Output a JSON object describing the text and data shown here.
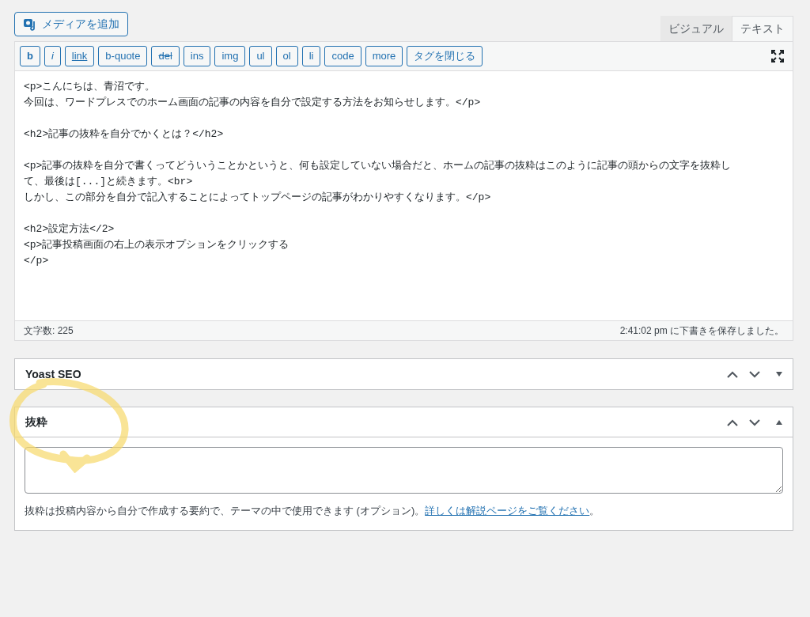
{
  "media_button": {
    "label": "メディアを追加"
  },
  "editor_tabs": [
    {
      "label": "ビジュアル",
      "selected": false
    },
    {
      "label": "テキスト",
      "selected": true
    }
  ],
  "quicktags": [
    {
      "label": "b",
      "kind": "bold"
    },
    {
      "label": "i",
      "kind": "italic"
    },
    {
      "label": "link",
      "kind": "underline"
    },
    {
      "label": "b-quote",
      "kind": "plain"
    },
    {
      "label": "del",
      "kind": "strike"
    },
    {
      "label": "ins",
      "kind": "plain"
    },
    {
      "label": "img",
      "kind": "plain"
    },
    {
      "label": "ul",
      "kind": "plain"
    },
    {
      "label": "ol",
      "kind": "plain"
    },
    {
      "label": "li",
      "kind": "plain"
    },
    {
      "label": "code",
      "kind": "plain"
    },
    {
      "label": "more",
      "kind": "plain"
    },
    {
      "label": "タグを閉じる",
      "kind": "plain"
    }
  ],
  "editor_blocks": [
    [
      "<p>こんにちは、青沼です。",
      "今回は、ワードプレスでのホーム画面の記事の内容を自分で設定する方法をお知らせします。</p>"
    ],
    [
      "<h2>記事の抜粋を自分でかくとは？</h2>"
    ],
    [
      "<p>記事の抜粋を自分で書くってどういうことかというと、何も設定していない場合だと、ホームの記事の抜粋はこのように記事の頭からの文字を抜粋し",
      "て、最後は[...]と続きます。<br>",
      "しかし、この部分を自分で記入することによってトップページの記事がわかりやすくなります。</p>"
    ],
    [
      "<h2>設定方法</2>",
      "<p>記事投稿画面の右上の表示オプションをクリックする",
      "</p>"
    ]
  ],
  "status_bar": {
    "word_count": "文字数: 225",
    "saved": "2:41:02 pm に下書きを保存しました。"
  },
  "panels": [
    {
      "title": "Yoast SEO",
      "expanded": false
    },
    {
      "title": "抜粋",
      "expanded": true,
      "help": "抜粋は投稿内容から自分で作成する要約で、テーマの中で使用できます (オプション)。",
      "link": "詳しくは解説ページをご覧ください",
      "end": "。"
    }
  ]
}
